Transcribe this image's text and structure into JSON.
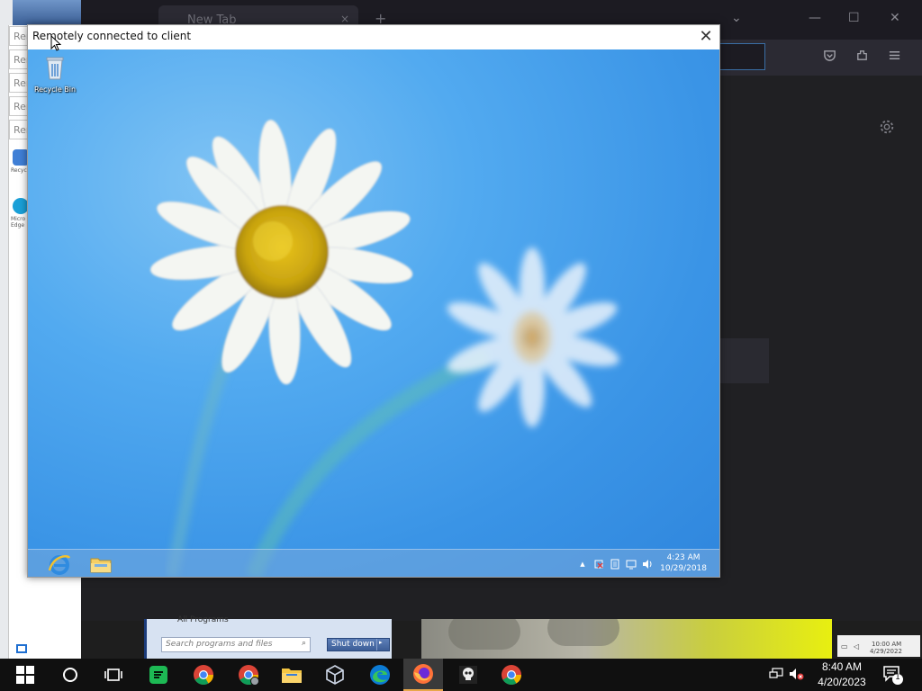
{
  "host_browser": {
    "tab_title": "New Tab",
    "tab_close": "×",
    "new_tab": "+",
    "list_all_tabs": "⌄",
    "window_controls": {
      "minimize": "—",
      "maximize": "☐",
      "close": "✕"
    },
    "toolbar_icons": {
      "pocket": "pocket-icon",
      "extensions": "extensions-icon",
      "menu": "hamburger-menu-icon"
    },
    "settings_icon": "gear-icon"
  },
  "host_left_panel": {
    "items": [
      "Rem",
      "Rem",
      "Rem",
      "Rem",
      "Rem"
    ],
    "desktop_labels": [
      "Recycle",
      "Micro Edge"
    ]
  },
  "host_start_menu": {
    "all_programs": "All Programs",
    "search_placeholder": "Search programs and files",
    "shutdown_label": "Shut down",
    "shutdown_arrow": "▸"
  },
  "host_overlay_clock": {
    "time": "10:00 AM",
    "date": "4/29/2022"
  },
  "remote_window": {
    "title": "Remotely connected to client",
    "close_glyph": "✕",
    "desktop": {
      "recycle_bin_label": "Recycle Bin"
    },
    "taskbar": {
      "pinned": [
        "internet-explorer-icon",
        "file-explorer-icon"
      ],
      "tray_chevron": "▲",
      "time": "4:23 AM",
      "date": "10/29/2018"
    }
  },
  "host_taskbar": {
    "pinned_apps": [
      "windows-start-icon",
      "cortana-search-icon",
      "task-view-icon",
      "sheets-app-icon",
      "chrome-icon",
      "chrome-profile-icon",
      "file-explorer-icon",
      "virtualbox-icon",
      "edge-icon",
      "firefox-icon",
      "skull-app-icon",
      "chrome-icon"
    ],
    "active_app": "firefox-icon",
    "time": "8:40 AM",
    "date": "4/20/2023",
    "notification_count": "1"
  },
  "colors": {
    "remote_wallpaper": "#3a94e6",
    "host_taskbar": "#101010",
    "active_indicator": "#e8a74a"
  }
}
